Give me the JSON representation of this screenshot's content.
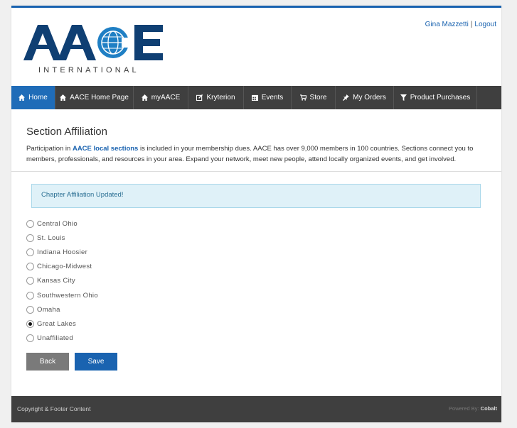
{
  "brand": {
    "logo_text": "AACE",
    "logo_sub": "INTERNATIONAL",
    "primary_color": "#1a63b0",
    "globe_color": "#1f7fc4"
  },
  "user": {
    "name": "Gina Mazzetti",
    "separator": "|",
    "logout": "Logout"
  },
  "nav": {
    "items": [
      {
        "label": "Home",
        "icon": "home-icon",
        "active": true
      },
      {
        "label": "AACE Home Page",
        "icon": "home-icon"
      },
      {
        "label": "myAACE",
        "icon": "home-icon"
      },
      {
        "label": "Kryterion",
        "icon": "edit-icon"
      },
      {
        "label": "Events",
        "icon": "calendar-icon"
      },
      {
        "label": "Store",
        "icon": "cart-icon"
      },
      {
        "label": "My Orders",
        "icon": "pin-icon"
      },
      {
        "label": "Product Purchases",
        "icon": "filter-icon"
      }
    ]
  },
  "main": {
    "title": "Section Affiliation",
    "desc_before": "Participation in ",
    "desc_link": "AACE local sections",
    "desc_after": " is included in your membership dues. AACE has over 9,000 members in 100 countries. Sections connect you to members, professionals, and resources in your area. Expand your network, meet new people, attend locally organized events, and get involved.",
    "alert": "Chapter Affiliation Updated!",
    "options": [
      {
        "label": "Central Ohio",
        "checked": false
      },
      {
        "label": "St. Louis",
        "checked": false
      },
      {
        "label": "Indiana Hoosier",
        "checked": false
      },
      {
        "label": "Chicago-Midwest",
        "checked": false
      },
      {
        "label": "Kansas City",
        "checked": false
      },
      {
        "label": "Southwestern Ohio",
        "checked": false
      },
      {
        "label": "Omaha",
        "checked": false
      },
      {
        "label": "Great Lakes",
        "checked": true
      },
      {
        "label": "Unaffiliated",
        "checked": false
      }
    ],
    "back_label": "Back",
    "save_label": "Save"
  },
  "footer": {
    "left": "Copyright & Footer Content",
    "powered_prefix": "Powered By:",
    "powered_brand": "Cobalt"
  }
}
